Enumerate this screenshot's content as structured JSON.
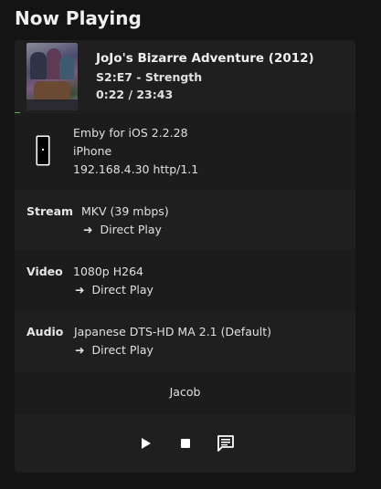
{
  "page": {
    "title": "Now Playing"
  },
  "media": {
    "title": "JoJo's Bizarre Adventure (2012)",
    "episode": "S2:E7 - Strength",
    "time": "0:22 / 23:43",
    "progress_fraction": 0.0155
  },
  "device": {
    "icon": "phone-icon",
    "app": "Emby for iOS 2.2.28",
    "name": "iPhone",
    "address": "192.168.4.30 http/1.1"
  },
  "stream": {
    "label": "Stream",
    "value": "MKV (39 mbps)",
    "arrow": "➜",
    "mode": "Direct Play"
  },
  "video": {
    "label": "Video",
    "value": "1080p H264",
    "arrow": "➜",
    "mode": "Direct Play"
  },
  "audio": {
    "label": "Audio",
    "value": "Japanese DTS-HD MA 2.1 (Default)",
    "arrow": "➜",
    "mode": "Direct Play"
  },
  "user": {
    "name": "Jacob"
  },
  "controls": [
    "play-icon",
    "stop-icon",
    "message-icon"
  ],
  "colors": {
    "accent": "#52b54b",
    "background": "#141414",
    "card": "#1f1f1f"
  }
}
